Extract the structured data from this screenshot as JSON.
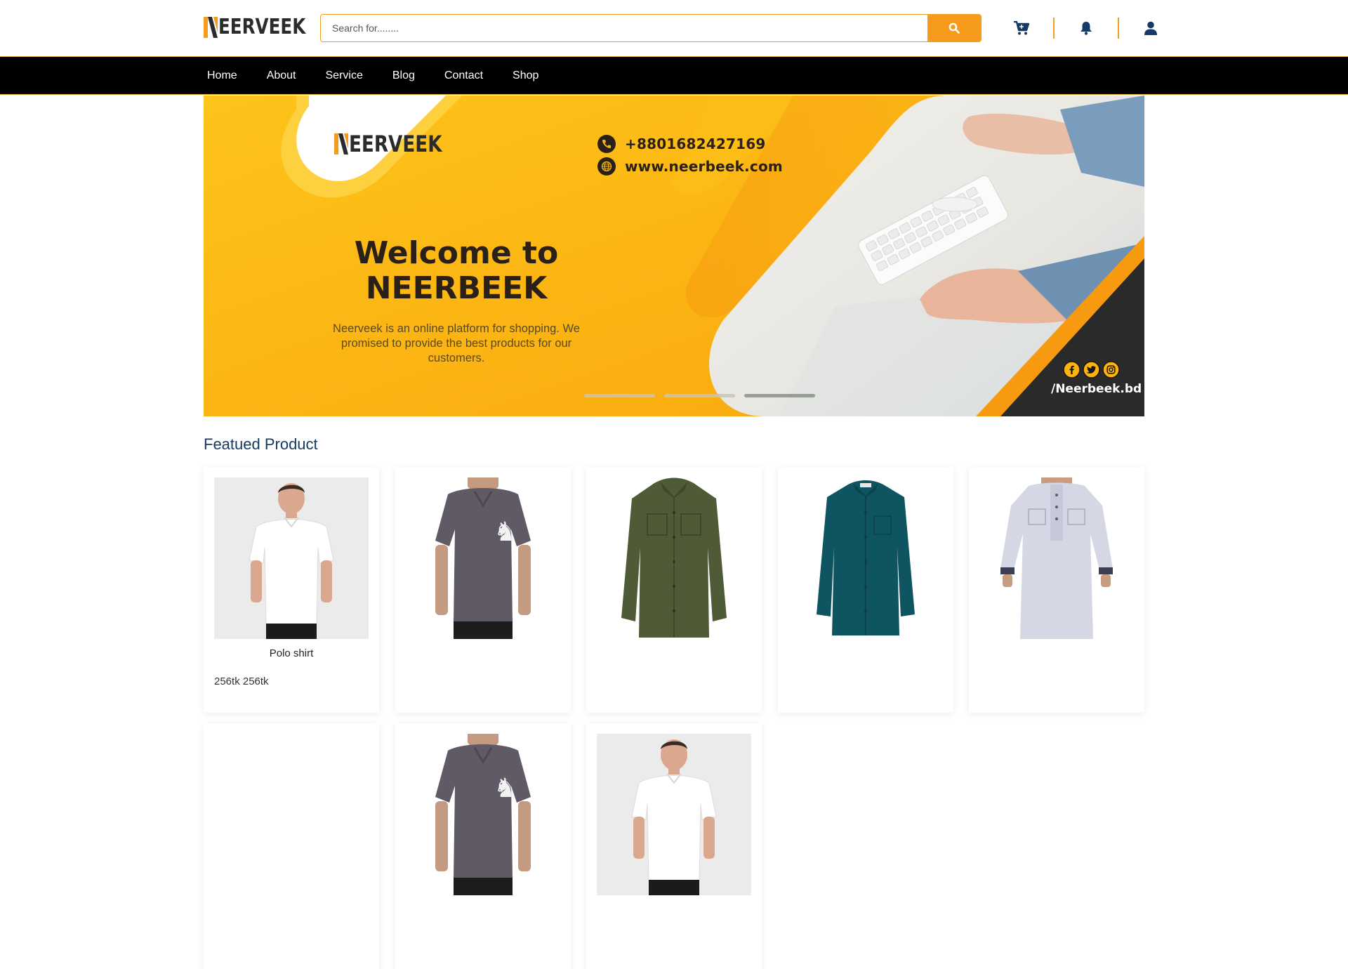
{
  "brand": {
    "name": "EERVEEK",
    "accent": "#f59a1b"
  },
  "search": {
    "placeholder": "Search for........"
  },
  "header_icons": [
    "cart-icon",
    "bell-icon",
    "user-icon"
  ],
  "nav": {
    "items": [
      "Home",
      "About",
      "Service",
      "Blog",
      "Contact",
      "Shop"
    ]
  },
  "banner": {
    "logo_text": "EERVEEK",
    "phone": "+8801682427169",
    "website": "www.neerbeek.com",
    "welcome_line1": "Welcome to",
    "welcome_line2": "NEERBEEK",
    "description": "Neerveek is an online platform for shopping. We promised to provide the best products for our customers.",
    "social_handle": "/Neerbeek.bd",
    "social_icons": [
      "facebook-icon",
      "twitter-icon",
      "instagram-icon"
    ],
    "slides": 3,
    "active_slide": 3
  },
  "featured": {
    "title": "Featued Product",
    "products": [
      {
        "image": "white-polo",
        "name": "Polo shirt",
        "price": "256tk 256tk"
      },
      {
        "image": "gray-polo",
        "name": "",
        "price": ""
      },
      {
        "image": "green-shirt",
        "name": "",
        "price": ""
      },
      {
        "image": "teal-shirt",
        "name": "",
        "price": ""
      },
      {
        "image": "punjabi",
        "name": "",
        "price": ""
      },
      {
        "image": "none",
        "name": "",
        "price": ""
      },
      {
        "image": "gray-polo",
        "name": "",
        "price": ""
      },
      {
        "image": "white-polo",
        "name": "",
        "price": ""
      }
    ]
  }
}
